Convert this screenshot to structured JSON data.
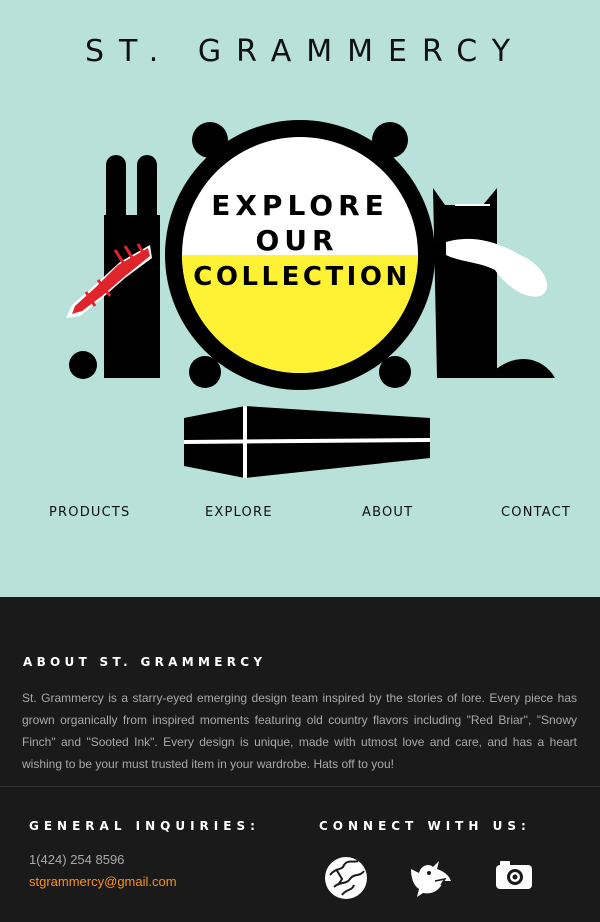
{
  "brand": {
    "title": "ST. GRAMMERCY"
  },
  "hero": {
    "line1": "EXPLORE",
    "line2": "OUR",
    "line3": "COLLECTION",
    "colors": {
      "background": "#b8e1d9",
      "yellow": "#fff133",
      "black": "#000000",
      "ribbon": "#e0242b"
    }
  },
  "nav": {
    "items": [
      {
        "label": "PRODUCTS"
      },
      {
        "label": "EXPLORE"
      },
      {
        "label": "ABOUT"
      },
      {
        "label": "CONTACT"
      }
    ]
  },
  "about": {
    "title": "ABOUT ST. GRAMMERCY",
    "text": "St. Grammercy is a starry-eyed emerging design team inspired by the stories of lore. Every piece has grown organically from inspired moments featuring old country flavors including \"Red Briar\", \"Snowy Finch\" and \"Sooted Ink\". Every design is unique, made with utmost love and care, and has a heart wishing to be your must trusted item in your wardrobe. Hats off to you!"
  },
  "inquiries": {
    "title": "GENERAL INQUIRIES:",
    "phone": "1(424) 254 8596",
    "email": "stgrammercy@gmail.com"
  },
  "connect": {
    "title": "CONNECT WITH US:",
    "icons": [
      "globe-icon",
      "bird-icon",
      "camera-icon"
    ]
  },
  "colors": {
    "footer_bg": "#1b1a1b",
    "accent": "#f7941d"
  }
}
